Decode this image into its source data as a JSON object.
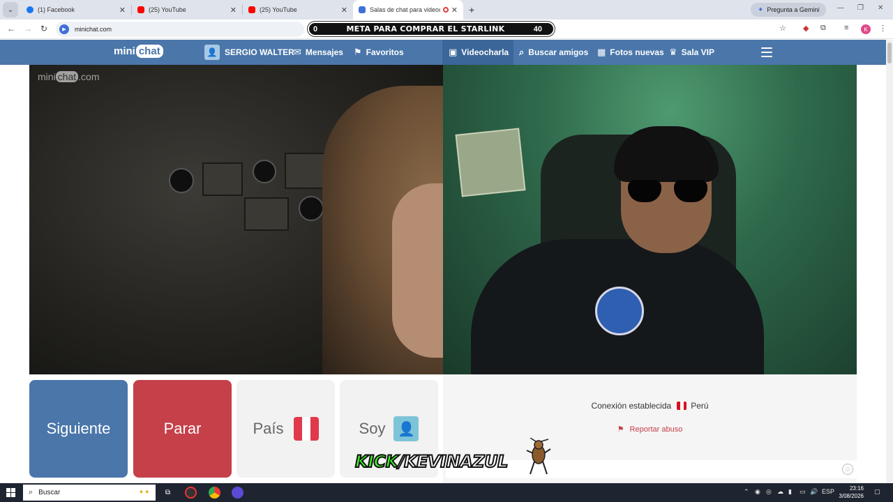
{
  "browser": {
    "tabs": [
      {
        "title": "(1) Facebook",
        "icon": "facebook-icon",
        "color": "#1877f2"
      },
      {
        "title": "(25) YouTube",
        "icon": "youtube-icon",
        "color": "#ff0000"
      },
      {
        "title": "(25) YouTube",
        "icon": "youtube-icon",
        "color": "#ff0000"
      },
      {
        "title": "Salas de chat para videocita",
        "icon": "minichat-icon",
        "color": "#3f6fd8",
        "active": true
      }
    ],
    "new_tab": "+",
    "gemini_label": "Pregunta a Gemini",
    "url": "minichat.com",
    "profile_initial": "K"
  },
  "stream_overlay": {
    "goal_left": "0",
    "goal_label": "META PARA COMPRAR EL STARLINK",
    "goal_right": "40",
    "kick_prefix": "KICK",
    "kick_suffix": "/KEVINAZUL"
  },
  "site": {
    "logo_mini": "mini",
    "logo_chat": "chat",
    "user_name": "SERGIO WALTER",
    "nav": {
      "messages": "Mensajes",
      "favorites": "Favoritos",
      "videochat": "Videocharla",
      "find_friends": "Buscar amigos",
      "new_photos": "Fotos nuevas",
      "vip_room": "Sala VIP"
    },
    "watermark_mini": "mini",
    "watermark_chat": "chat",
    "watermark_com": ".com"
  },
  "controls": {
    "next": "Siguiente",
    "stop": "Parar",
    "country": "País",
    "gender": "Soy"
  },
  "chat": {
    "connection_text": "Conexión establecida",
    "country": "Perú",
    "report": "Reportar abuso",
    "input_placeholder": ""
  },
  "colors": {
    "brand_blue": "#4a76aa",
    "stop_red": "#c54049",
    "peru_red": "#d91023"
  },
  "taskbar": {
    "search_placeholder": "Buscar",
    "language": "ESP",
    "time": "23:16",
    "date": "3/08/2026"
  }
}
